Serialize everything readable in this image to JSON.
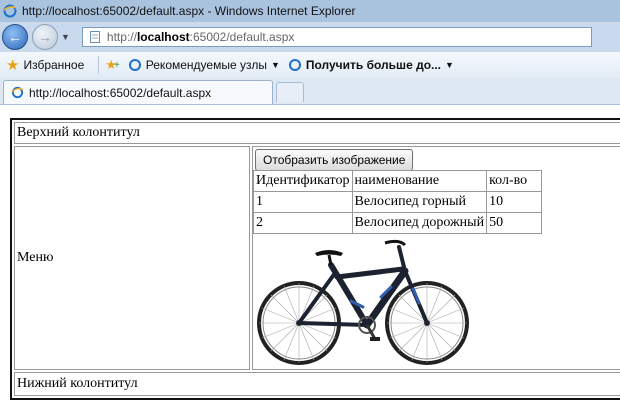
{
  "window": {
    "title": "http://localhost:65002/default.aspx - Windows Internet Explorer"
  },
  "address_bar": {
    "prefix": "http://",
    "host": "localhost",
    "rest": ":65002/default.aspx"
  },
  "favorites_bar": {
    "favorites_label": "Избранное",
    "suggested_label": "Рекомендуемые узлы",
    "more_label": "Получить больше до..."
  },
  "tab": {
    "label": "http://localhost:65002/default.aspx"
  },
  "page": {
    "header_text": "Верхний колонтитул",
    "menu_text": "Меню",
    "footer_text": "Нижний колонтитул",
    "show_button_label": "Отобразить изображение",
    "table": {
      "columns": [
        "Идентификатор",
        "наименование",
        "кол-во"
      ],
      "rows": [
        [
          "1",
          "Велосипед горный",
          "10"
        ],
        [
          "2",
          "Велосипед дорожный",
          "50"
        ]
      ]
    }
  },
  "colors": {
    "titlebar": "#a9c3df",
    "navbar": "#c9daee",
    "bike_frame": "#1c2230",
    "bike_accent": "#2f5fb0"
  },
  "icons": [
    "ie-icon",
    "back-arrow-icon",
    "forward-arrow-icon",
    "page-icon",
    "star-icon",
    "add-favorite-icon",
    "ie-small-icon",
    "new-tab-icon"
  ]
}
